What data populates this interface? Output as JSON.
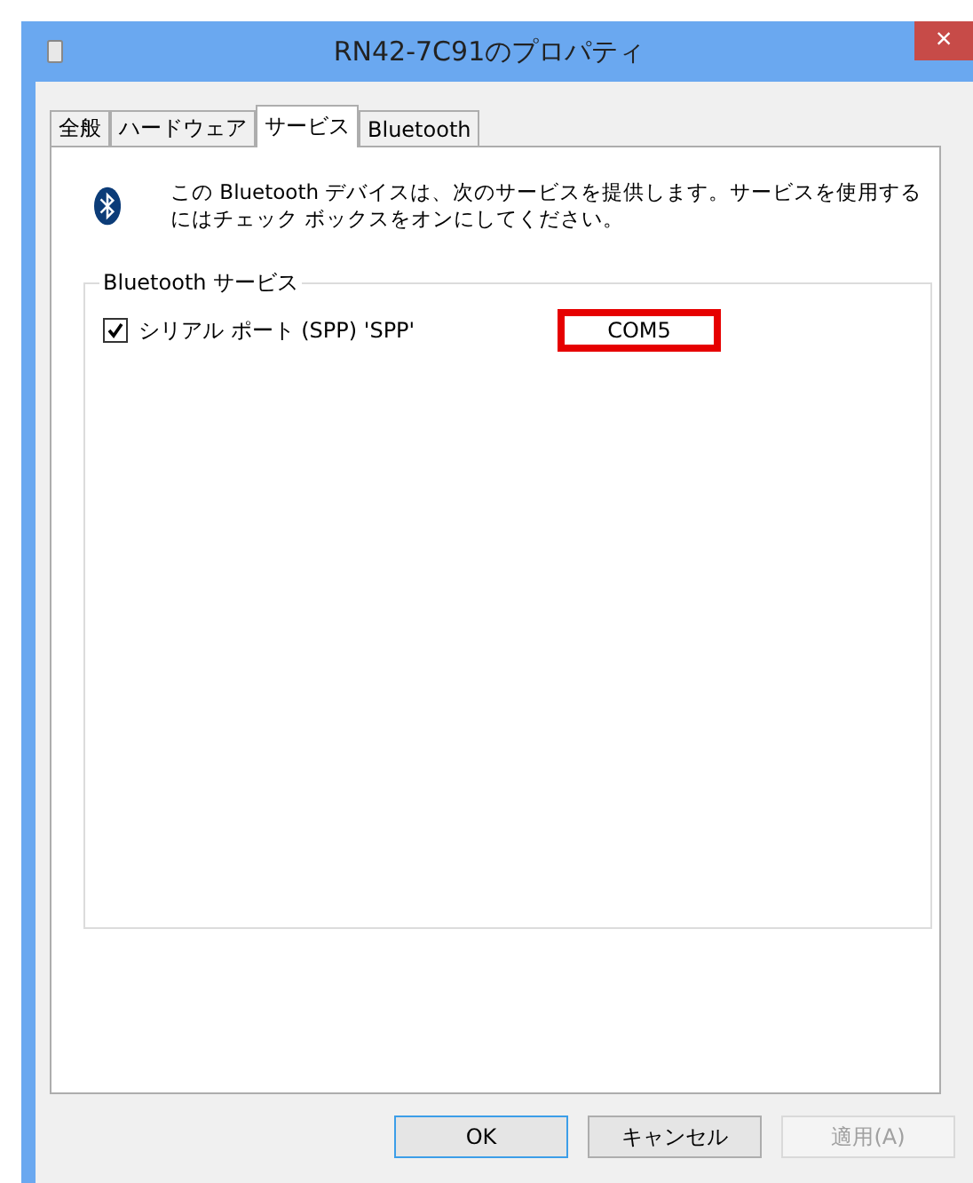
{
  "window": {
    "title": "RN42-7C91のプロパティ",
    "close": "×"
  },
  "tabs": [
    {
      "label": "全般",
      "selected": false
    },
    {
      "label": "ハードウェア",
      "selected": false
    },
    {
      "label": "サービス",
      "selected": true
    },
    {
      "label": "Bluetooth",
      "selected": false
    }
  ],
  "description": "この Bluetooth デバイスは、次のサービスを提供します。サービスを使用するにはチェック ボックスをオンにしてください。",
  "group": {
    "title": "Bluetooth サービス",
    "services": [
      {
        "name": "シリアル ポート (SPP) 'SPP'",
        "checked": true,
        "port": "COM5"
      }
    ]
  },
  "buttons": [
    {
      "label": "OK",
      "kind": "default",
      "disabled": false
    },
    {
      "label": "キャンセル",
      "kind": "normal",
      "disabled": false
    },
    {
      "label": "適用(A)",
      "kind": "normal",
      "disabled": true
    }
  ]
}
